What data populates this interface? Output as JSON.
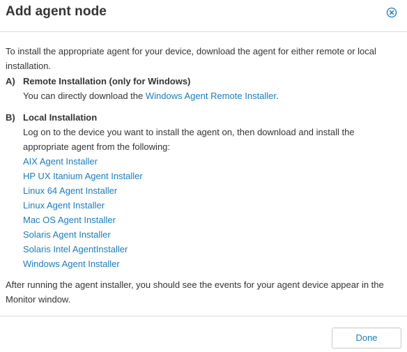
{
  "dialog": {
    "title": "Add agent node",
    "close_icon": "close-circle-icon"
  },
  "content": {
    "intro": "To install the appropriate agent for your device, download the agent for either remote or local installation.",
    "section_a": {
      "letter": "A)",
      "title": "Remote Installation (only for Windows)",
      "text_prefix": "You can directly download the ",
      "link": "Windows Agent Remote Installer",
      "text_suffix": "."
    },
    "section_b": {
      "letter": "B)",
      "title": "Local Installation",
      "text": "Log on to the device you want to install the agent on, then download and install the appropriate agent from the following:",
      "links": [
        "AIX Agent Installer",
        "HP UX Itanium Agent Installer",
        "Linux 64 Agent Installer",
        "Linux Agent Installer",
        "Mac OS Agent Installer",
        "Solaris Agent Installer",
        "Solaris Intel AgentInstaller",
        "Windows Agent Installer"
      ]
    },
    "outro": "After running the agent installer, you should see the events for your agent device appear in the Monitor window."
  },
  "footer": {
    "done_label": "Done"
  },
  "colors": {
    "link": "#1a7dbf",
    "text": "#333333",
    "divider": "#dcdcdc"
  }
}
